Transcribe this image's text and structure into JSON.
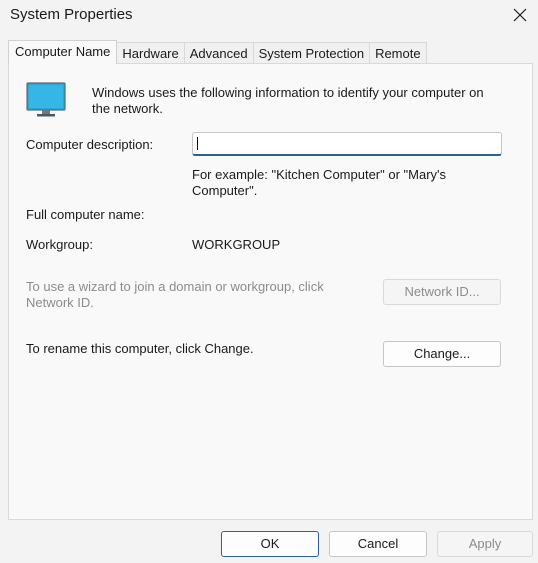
{
  "window": {
    "title": "System Properties"
  },
  "tabs": [
    {
      "label": "Computer Name",
      "active": true
    },
    {
      "label": "Hardware"
    },
    {
      "label": "Advanced"
    },
    {
      "label": "System Protection"
    },
    {
      "label": "Remote"
    }
  ],
  "computer_name": {
    "intro_line1": "Windows uses the following information to identify your computer on",
    "intro_line2": "the network.",
    "description_label": "Computer description:",
    "description_value": "",
    "example_line1": "For example: \"Kitchen Computer\" or \"Mary's",
    "example_line2": "Computer\".",
    "full_name_label": "Full computer name:",
    "full_name_value": "",
    "workgroup_label": "Workgroup:",
    "workgroup_value": "WORKGROUP",
    "wizard_line1": "To use a wizard to join a domain or workgroup, click",
    "wizard_line2": "Network ID.",
    "network_id_button": "Network ID...",
    "rename_text": "To rename this computer, click Change.",
    "change_button": "Change..."
  },
  "footer": {
    "ok": "OK",
    "cancel": "Cancel",
    "apply": "Apply"
  },
  "icons": {
    "close": "close-icon",
    "monitor": "monitor-icon"
  },
  "colors": {
    "accent": "#2e5e9e",
    "monitor": "#2aa6d8"
  }
}
